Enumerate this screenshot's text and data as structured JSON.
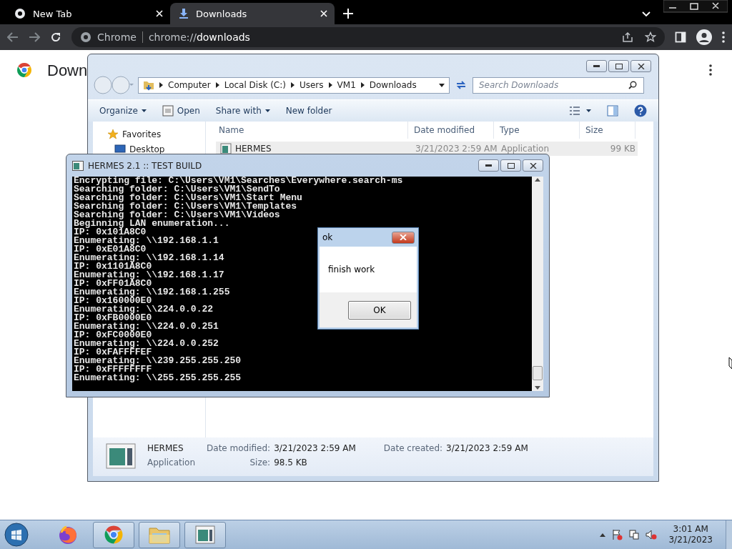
{
  "browser": {
    "tabs": [
      {
        "title": "New Tab",
        "kind": "newtab",
        "selected": false
      },
      {
        "title": "Downloads",
        "kind": "download",
        "selected": true
      }
    ],
    "omnibox": {
      "site": "Chrome",
      "url_prefix": "chrome://",
      "url_path": "downloads"
    },
    "page_title": "Down"
  },
  "explorer": {
    "breadcrumbs": [
      "Computer",
      "Local Disk (C:)",
      "Users",
      "VM1",
      "Downloads"
    ],
    "search": {
      "placeholder": "Search Downloads"
    },
    "toolbar": [
      {
        "label": "Organize",
        "kind": "menu"
      },
      {
        "label": "Open",
        "kind": "icon"
      },
      {
        "label": "Share with",
        "kind": "menu"
      },
      {
        "label": "New folder",
        "kind": "plain"
      }
    ],
    "nav": [
      {
        "label": "Favorites",
        "kind": "star"
      },
      {
        "label": "Desktop",
        "kind": "desktop"
      }
    ],
    "columns": [
      "Name",
      "Date modified",
      "Type",
      "Size"
    ],
    "files": [
      {
        "name": "HERMES",
        "date": "3/21/2023 2:59 AM",
        "type": "Application",
        "size": "99 KB",
        "selected": true
      }
    ],
    "details": {
      "name": "HERMES",
      "type": "Application",
      "fields": [
        {
          "label": "Date modified:",
          "value": "3/21/2023 2:59 AM"
        },
        {
          "label": "Size:",
          "value": "98.5 KB"
        },
        {
          "label": "Date created:",
          "value": "3/21/2023 2:59 AM"
        }
      ]
    }
  },
  "console": {
    "title": "HERMES 2.1 :: TEST BUILD",
    "lines": [
      "Encrypting file: C:\\Users\\VM1\\Searches\\Everywhere.search-ms",
      "Searching folder: C:\\Users\\VM1\\SendTo",
      "Searching folder: C:\\Users\\VM1\\Start Menu",
      "Searching folder: C:\\Users\\VM1\\Templates",
      "Searching folder: C:\\Users\\VM1\\Videos",
      "Beginning LAN enumeration...",
      "IP: 0x101A8C0",
      "Enumerating: \\\\192.168.1.1",
      "IP: 0xE01A8C0",
      "Enumerating: \\\\192.168.1.14",
      "IP: 0x1101A8C0",
      "Enumerating: \\\\192.168.1.17",
      "IP: 0xFF01A8C0",
      "Enumerating: \\\\192.168.1.255",
      "IP: 0x160000E0",
      "Enumerating: \\\\224.0.0.22",
      "IP: 0xFB0000E0",
      "Enumerating: \\\\224.0.0.251",
      "IP: 0xFC0000E0",
      "Enumerating: \\\\224.0.0.252",
      "IP: 0xFAFFFFEF",
      "Enumerating: \\\\239.255.255.250",
      "IP: 0xFFFFFFFF",
      "Enumerating: \\\\255.255.255.255"
    ]
  },
  "dialog": {
    "title": "ok",
    "message": "finish work",
    "button": "OK"
  },
  "taskbar": {
    "apps": [
      {
        "kind": "firefox",
        "running": false
      },
      {
        "kind": "chrome",
        "running": true
      },
      {
        "kind": "folder",
        "running": true
      },
      {
        "kind": "program",
        "running": true
      }
    ],
    "clock": {
      "time": "3:01 AM",
      "date": "3/21/2023"
    }
  }
}
